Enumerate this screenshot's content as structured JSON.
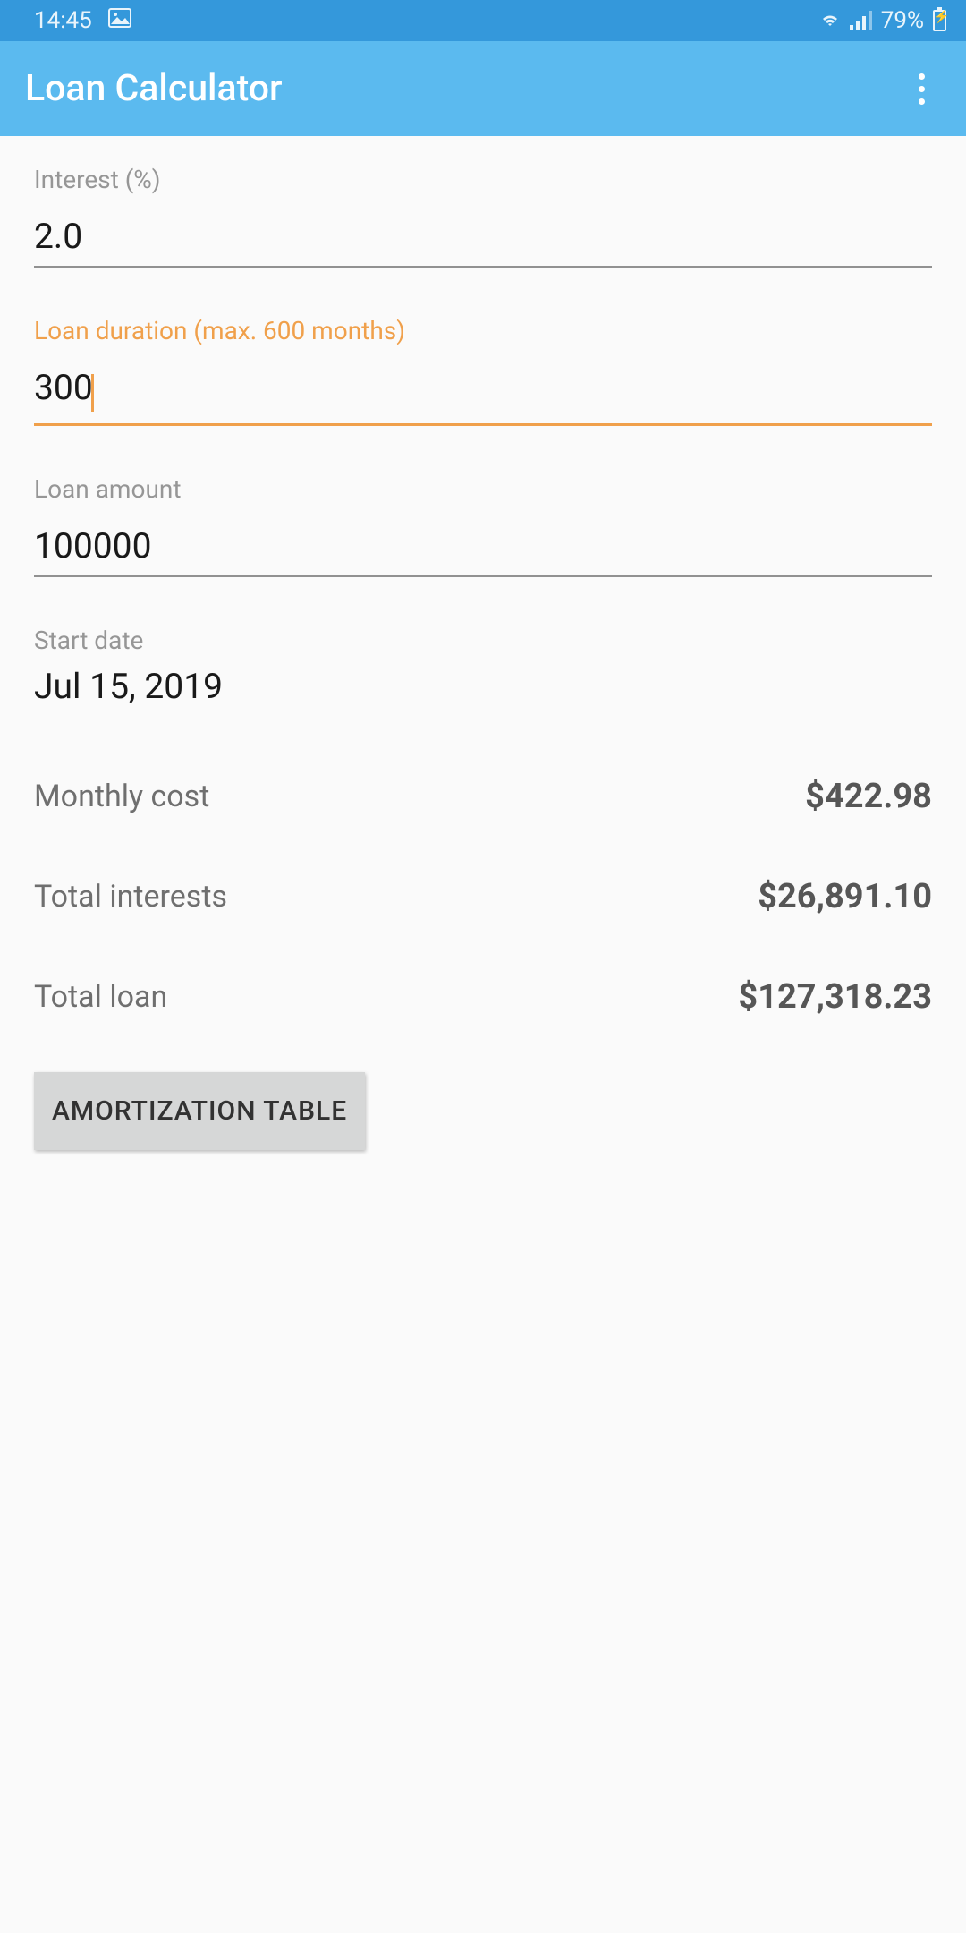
{
  "status": {
    "time": "14:45",
    "battery": "79%"
  },
  "header": {
    "title": "Loan Calculator"
  },
  "fields": {
    "interest": {
      "label": "Interest (%)",
      "value": "2.0"
    },
    "duration": {
      "label": "Loan duration (max. 600 months)",
      "value": "300"
    },
    "amount": {
      "label": "Loan amount",
      "value": "100000"
    },
    "startDate": {
      "label": "Start date",
      "value": "Jul 15, 2019"
    }
  },
  "results": {
    "monthlyCost": {
      "label": "Monthly cost",
      "value": "$422.98"
    },
    "totalInterests": {
      "label": "Total interests",
      "value": "$26,891.10"
    },
    "totalLoan": {
      "label": "Total loan",
      "value": "$127,318.23"
    }
  },
  "buttons": {
    "amortization": "AMORTIZATION TABLE"
  }
}
